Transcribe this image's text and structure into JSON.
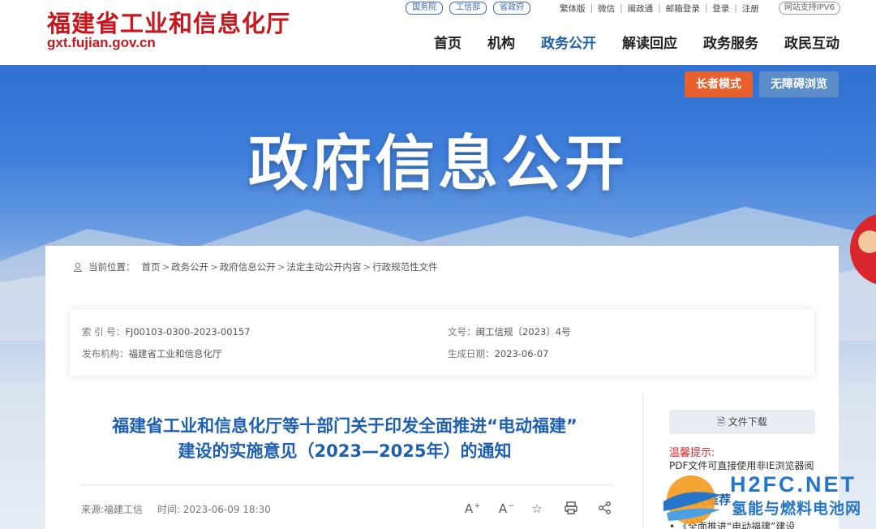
{
  "header": {
    "site_title": "福建省工业和信息化厅",
    "domain": "gxt.fujian.gov.cn",
    "pills": [
      "国务院",
      "工信部",
      "省政府"
    ],
    "links": [
      "繁体版",
      "微信",
      "闽政通",
      "邮箱登录",
      "登录",
      "注册"
    ],
    "ipv6": "网站支持IPV6",
    "nav": [
      "首页",
      "机构",
      "政务公开",
      "解读回应",
      "政务服务",
      "政民互动"
    ],
    "active_nav": "政务公开"
  },
  "banner": {
    "title": "政府信息公开",
    "elder_mode": "长者模式",
    "accessible": "无障碍浏览"
  },
  "breadcrumb": {
    "label": "当前位置：",
    "items": [
      "首页",
      "政务公开",
      "政府信息公开",
      "法定主动公开内容",
      "行政规范性文件"
    ],
    "separator": ">"
  },
  "meta": {
    "index_label": "索 引 号：",
    "index_value": "FJ00103-0300-2023-00157",
    "docno_label": "文号：",
    "docno_value": "闽工信规〔2023〕4号",
    "org_label": "发布机构：",
    "org_value": "福建省工业和信息化厅",
    "date_label": "生成日期：",
    "date_value": "2023-06-07"
  },
  "article": {
    "title_line1": "福建省工业和信息化厅等十部门关于印发全面推进“电动福建”",
    "title_line2": "建设的实施意见（2023—2025年）的通知",
    "source": "来源:福建工信",
    "time": "时间:  2023-06-09 18:30"
  },
  "sidebar": {
    "download": "文件下载",
    "tip_title": "温馨提示:",
    "tip_text": "PDF文件可直接使用非IE浏览器阅",
    "related_title": "相关推荐",
    "related_item": "• 《全面推进“电动福建”建设"
  },
  "watermark": {
    "en": "H2FC.NET",
    "cn": "氢能与燃料电池网"
  }
}
